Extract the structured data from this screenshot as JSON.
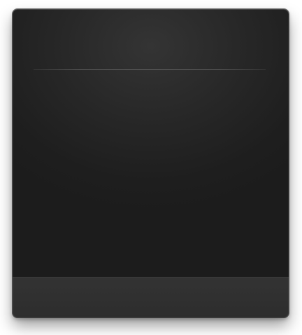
{
  "window": {
    "title": ""
  },
  "footer": {
    "label": ""
  },
  "colors": {
    "panel_background": "#1f1f1f",
    "panel_highlight": "#343434",
    "footer_background": "#303030",
    "divider": "#5a5a5a"
  }
}
